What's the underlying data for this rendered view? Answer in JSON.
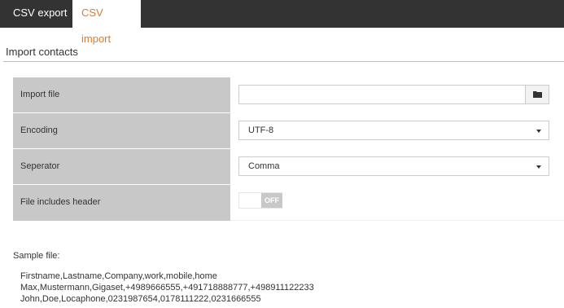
{
  "tabs": {
    "export_label": "CSV export",
    "import_label": "CSV import"
  },
  "section": {
    "title": "Import contacts"
  },
  "form": {
    "import_file_label": "Import file",
    "import_file_value": "",
    "encoding_label": "Encoding",
    "encoding_value": "UTF-8",
    "separator_label": "Seperator",
    "separator_value": "Comma",
    "header_label": "File includes header",
    "header_toggle_state": "OFF"
  },
  "sample": {
    "label": "Sample file:",
    "lines": [
      "Firstname,Lastname,Company,work,mobile,home",
      "Max,Mustermann,Gigaset,+4989666555,+491718888777,+498911122233",
      "John,Doe,Locaphone,0231987654,0178111222,0231666555"
    ]
  },
  "colors": {
    "tabbar_bg": "#333333",
    "active_tab_text": "#e07a2e",
    "label_bg": "#c8c8c8"
  },
  "icons": {
    "file_button": "folder-icon",
    "select_caret": "caret-down-icon"
  }
}
